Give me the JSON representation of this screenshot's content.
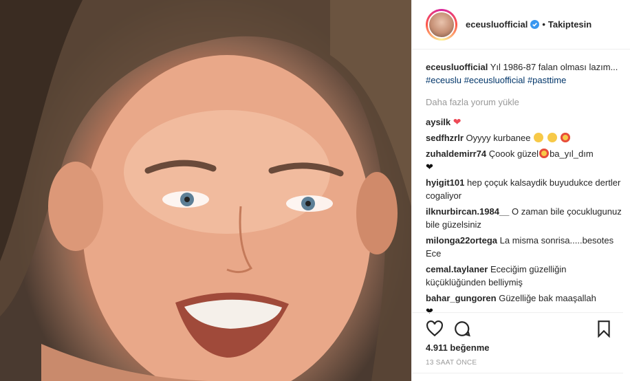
{
  "post": {
    "username": "eceusluofficial",
    "separator": "•",
    "follow_label": "Takiptesin",
    "caption_user": "eceusluofficial",
    "caption_text": "Yıl 1986-87 falan olması lazım...",
    "hashtags": [
      "#eceuslu",
      "#eceusluofficial",
      "#pasttime"
    ],
    "load_more": "Daha fazla yorum yükle",
    "likes": "4.911 beğenme",
    "time": "13 SAAT ÖNCE"
  },
  "comments": [
    {
      "user": "aysilk",
      "text": ""
    },
    {
      "user": "sedfhzrlr",
      "text": "Oyyyy kurbanee"
    },
    {
      "user": "zuhaldemirr74",
      "text": "Çoook güzel",
      "text2": "ba_yıl_dım"
    },
    {
      "user": "hyigit101",
      "text": "hep çoçuk kalsaydik buyudukce dertler cogaliyor"
    },
    {
      "user": "ilknurbircan.1984__",
      "text": "O zaman bile çocuklugunuz bile güzelsiniz"
    },
    {
      "user": "milonga22ortega",
      "text": "La misma sonrisa.....besotes Ece"
    },
    {
      "user": "cemal.taylaner",
      "text": "Ececiğim güzelliğin küçüklüğünden belliymiş"
    },
    {
      "user": "bahar_gungoren",
      "text": "Güzelliğe bak maaşallah"
    }
  ],
  "colors": {
    "like_red": "#ed4956",
    "hashtag": "#003569",
    "verified": "#3897f0"
  },
  "icons": [
    "heart-icon",
    "comment-icon",
    "bookmark-icon",
    "verified-badge-icon"
  ]
}
